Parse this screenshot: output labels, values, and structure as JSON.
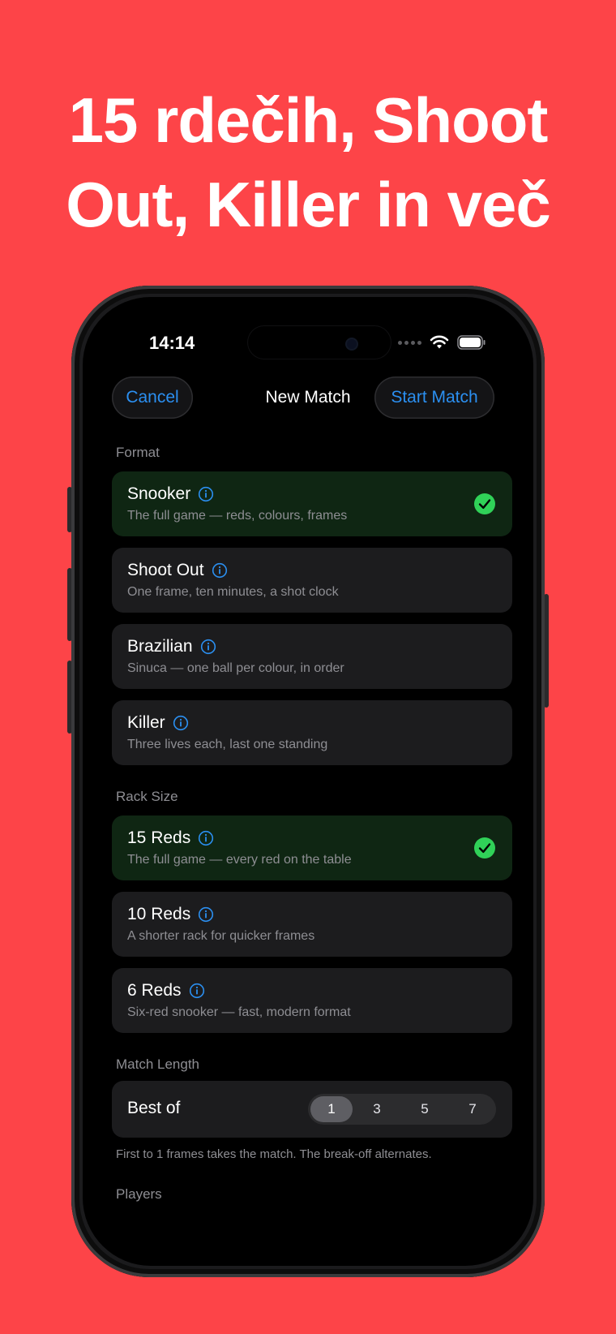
{
  "headline": {
    "line1": "15 rdečih, Shoot",
    "line2": "Out, Killer in več"
  },
  "status_bar": {
    "time": "14:14"
  },
  "nav": {
    "cancel_label": "Cancel",
    "title": "New Match",
    "start_label": "Start Match"
  },
  "sections": {
    "format": "Format",
    "rack_size": "Rack Size",
    "match_length": "Match Length",
    "players": "Players"
  },
  "formats": [
    {
      "title": "Snooker",
      "subtitle": "The full game — reds, colours, frames",
      "selected": true
    },
    {
      "title": "Shoot Out",
      "subtitle": "One frame, ten minutes, a shot clock",
      "selected": false
    },
    {
      "title": "Brazilian",
      "subtitle": "Sinuca — one ball per colour, in order",
      "selected": false
    },
    {
      "title": "Killer",
      "subtitle": "Three lives each, last one standing",
      "selected": false
    }
  ],
  "racks": [
    {
      "title": "15 Reds",
      "subtitle": "The full game — every red on the table",
      "selected": true
    },
    {
      "title": "10 Reds",
      "subtitle": "A shorter rack for quicker frames",
      "selected": false
    },
    {
      "title": "6 Reds",
      "subtitle": "Six-red snooker — fast, modern format",
      "selected": false
    }
  ],
  "match_length": {
    "label": "Best of",
    "options": [
      "1",
      "3",
      "5",
      "7"
    ],
    "selected": "1",
    "footnote": "First to 1 frames takes the match. The break-off alternates."
  },
  "colors": {
    "background": "#fd4448",
    "accent": "#2b8ff0",
    "selected_card": "#0f2613",
    "check": "#30d158"
  },
  "icons": {
    "info": "info-circle-icon",
    "check": "checkmark-circle-icon",
    "wifi": "wifi-icon",
    "battery": "battery-icon",
    "signal": "cellular-dots-icon"
  }
}
